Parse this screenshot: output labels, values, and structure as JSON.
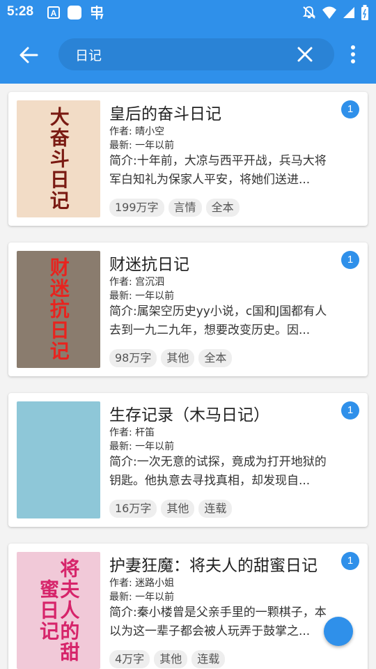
{
  "status_bar": {
    "time": "5:28",
    "left_icons": [
      "text-a-icon",
      "square-app-icon",
      "bug-icon"
    ],
    "right_icons": [
      "notification-off-icon",
      "wifi-icon",
      "signal-icon",
      "battery-icon"
    ]
  },
  "toolbar": {
    "search_value": "日记",
    "back_icon": "arrow-left-icon",
    "clear_icon": "close-icon",
    "more_icon": "more-vert-icon"
  },
  "results": [
    {
      "title": "皇后的奋斗日记",
      "author": "作者: 晴小空",
      "latest": "最新: 一年以前",
      "intro": "简介:十年前，大凉与西平开战，兵马大将军白知礼为保家人平安，将她们送进...",
      "tags": [
        "199万字",
        "言情",
        "全本"
      ],
      "badge": "1",
      "cover_text": "大奋斗日记",
      "cover_bg": "#f2dcc6",
      "cover_fg": "#7a1a12"
    },
    {
      "title": "财迷抗日记",
      "author": "作者: 宫沉泗",
      "latest": "最新: 一年以前",
      "intro": "简介:属架空历史yy小说，c国和J国都有人去到一九二九年，想要改变历史。因...",
      "tags": [
        "98万字",
        "其他",
        "全本"
      ],
      "badge": "1",
      "cover_text": "财迷抗日记",
      "cover_bg": "#8a7c6e",
      "cover_fg": "#e8231e"
    },
    {
      "title": "生存记录（木马日记）",
      "author": "作者: 杆笛",
      "latest": "最新: 一年以前",
      "intro": "简介:一次无意的试探，竟成为打开地狱的钥匙。他执意去寻找真相，却发现自...",
      "tags": [
        "16万字",
        "其他",
        "连载"
      ],
      "badge": "1",
      "cover_text": "",
      "cover_bg": "#8ec7d8",
      "cover_fg": "#ffffff"
    },
    {
      "title": "护妻狂魔：将夫人的甜蜜日记",
      "author": "作者: 迷路小姐",
      "latest": "最新: 一年以前",
      "intro": "简介:秦小楼曾是父亲手里的一颗棋子，本以为这一辈子都会被人玩弄于鼓掌之...",
      "tags": [
        "4万字",
        "其他",
        "连载"
      ],
      "badge": "1",
      "cover_text": "将夫人的甜蜜日记",
      "cover_bg": "#f1c9d8",
      "cover_fg": "#d6246a"
    }
  ],
  "colors": {
    "primary": "#2f90ea",
    "background": "#f3f3f3"
  }
}
